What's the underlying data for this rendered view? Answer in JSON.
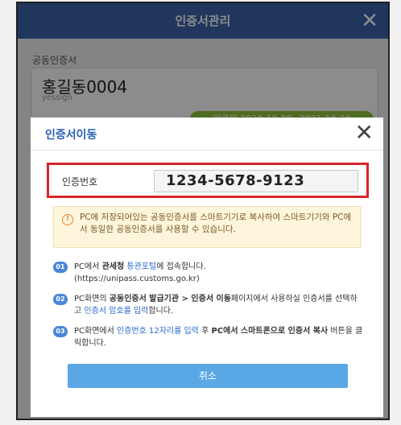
{
  "window": {
    "title": "인증서관리",
    "section_label": "공동인증서",
    "cert_name": "홍길동0004",
    "cert_issuer": "yessign",
    "cert_expiry": "만료일 2020-10-20~2021-10-20"
  },
  "modal": {
    "title": "인증서이동",
    "code_label": "인증번호",
    "code_value": "1234-5678-9123",
    "notice_icon": "!",
    "notice_text": "PC에 저장되어있는 공동인증서를 스마트기기로 복사하여 스마트기기와 PC에서 동일한 공동인증서를 사용할 수 있습니다.",
    "steps": [
      {
        "num": "01",
        "t1": "PC에서 ",
        "t2": "관세청",
        "t3": " 통관포털",
        "t4": "에 접속합니다.",
        "t5": "(https://unipass.customs.go.kr)"
      },
      {
        "num": "02",
        "t1": "PC화면의 ",
        "t2": "공동인증서 발급기관 > 인증서 이동",
        "t3": "페이지에서 사용하실 인증서를 선택하고 ",
        "t4": "인증서 암호를 입력",
        "t5": "합니다."
      },
      {
        "num": "03",
        "t1": "PC화면에서 ",
        "t2": "인증번호 12자리를 입력",
        "t3": " 후 ",
        "t4": "PC에서 스마트폰으로 인증서 복사",
        "t5": " 버튼을 클릭합니다."
      }
    ],
    "cancel_label": "취소"
  },
  "icons": {
    "close": "close-icon",
    "notice": "info-icon"
  },
  "colors": {
    "header": "#3b63a8",
    "highlight_border": "#d9242b",
    "button": "#5aa7e6",
    "accent_text": "#2a6ad1"
  }
}
